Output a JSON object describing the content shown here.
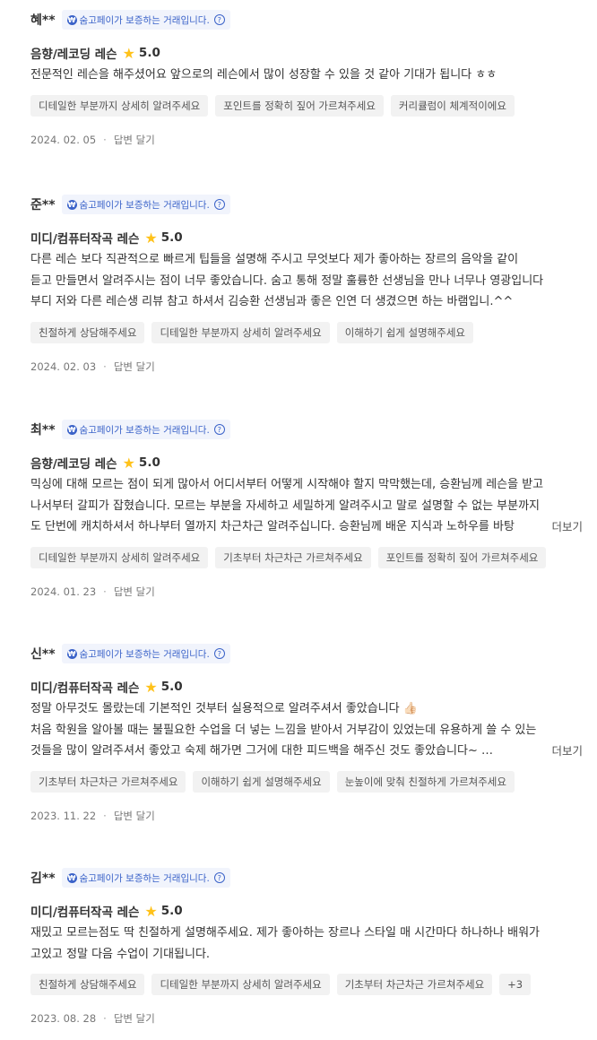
{
  "badge_text": "숨고페이가 보증하는 거래입니다.",
  "more_label": "더보기",
  "reply_label": "답변 달기",
  "star_color": "#ffc21a",
  "badge_color": "#3b63c9",
  "reviews": [
    {
      "name": "혜**",
      "course": "음향/레코딩 레슨",
      "score": "5.0",
      "lines": [
        "전문적인 레슨을 해주셨어요 앞으로의 레슨에서 많이 성장할 수 있을 것 같아 기대가 됩니다 ㅎㅎ"
      ],
      "tags": [
        "디테일한 부분까지 상세히 알려주세요",
        "포인트를 정확히 짚어 가르쳐주세요",
        "커리큘럼이 체계적이에요"
      ],
      "date": "2024. 02. 05"
    },
    {
      "name": "준**",
      "course": "미디/컴퓨터작곡 레슨",
      "score": "5.0",
      "lines": [
        "다른 레슨 보다 직관적으로 빠르게 팁들을 설명해 주시고 무엇보다 제가 좋아하는 장르의 음악을 같이",
        "듣고 만들면서 알려주시는 점이 너무 좋았습니다. 숨고 통해 정말 훌륭한 선생님을 만나 너무나 영광입니다",
        "부디 저와 다른 레슨생 리뷰 참고 하셔서 김승환 선생님과 좋은 인연 더 생겼으면 하는 바램입니.^^"
      ],
      "tags": [
        "친절하게 상담해주세요",
        "디테일한 부분까지 상세히 알려주세요",
        "이해하기 쉽게 설명해주세요"
      ],
      "date": "2024. 02. 03"
    },
    {
      "name": "최**",
      "course": "음향/레코딩 레슨",
      "score": "5.0",
      "lines": [
        "믹싱에 대해 모르는 점이 되게 많아서 어디서부터 어떻게 시작해야 할지 막막했는데, 승환님께 레슨을 받고",
        "나서부터 갈피가 잡혔습니다. 모르는 부분을 자세하고 세밀하게 알려주시고 말로 설명할 수 없는 부분까지",
        "도 단번에 캐치하셔서 하나부터 열까지 차근차근 알려주십니다. 승환님께 배운 지식과 노하우를 바탕"
      ],
      "tags": [
        "디테일한 부분까지 상세히 알려주세요",
        "기초부터 차근차근 가르쳐주세요",
        "포인트를 정확히 짚어 가르쳐주세요"
      ],
      "date": "2024. 01. 23"
    },
    {
      "name": "신**",
      "course": "미디/컴퓨터작곡 레슨",
      "score": "5.0",
      "lines": [
        "정말 아무것도 몰랐는데 기본적인 것부터 실용적으로 알려주셔서 좋았습니다 👍🏻",
        "처음 학원을 알아볼 때는 불필요한 수업을 더 넣는 느낌을 받아서 거부감이 있었는데 유용하게 쓸 수 있는",
        "것들을 많이 알려주셔서 좋았고 숙제 해가면 그거에 대한 피드백을 해주신 것도 좋았습니다~ …"
      ],
      "tags": [
        "기초부터 차근차근 가르쳐주세요",
        "이해하기 쉽게 설명해주세요",
        "눈높이에 맞춰 친절하게 가르쳐주세요"
      ],
      "date": "2023. 11. 22"
    },
    {
      "name": "김**",
      "course": "미디/컴퓨터작곡 레슨",
      "score": "5.0",
      "lines": [
        "재밌고 모르는점도 딱 친절하게 설명해주세요. 제가 좋아하는 장르나 스타일 매 시간마다 하나하나 배워가",
        "고있고 정말 다음 수업이 기대됩니다."
      ],
      "tags": [
        "친절하게 상담해주세요",
        "디테일한 부분까지 상세히 알려주세요",
        "기초부터 차근차근 가르쳐주세요",
        "+3"
      ],
      "date": "2023. 08. 28"
    }
  ]
}
